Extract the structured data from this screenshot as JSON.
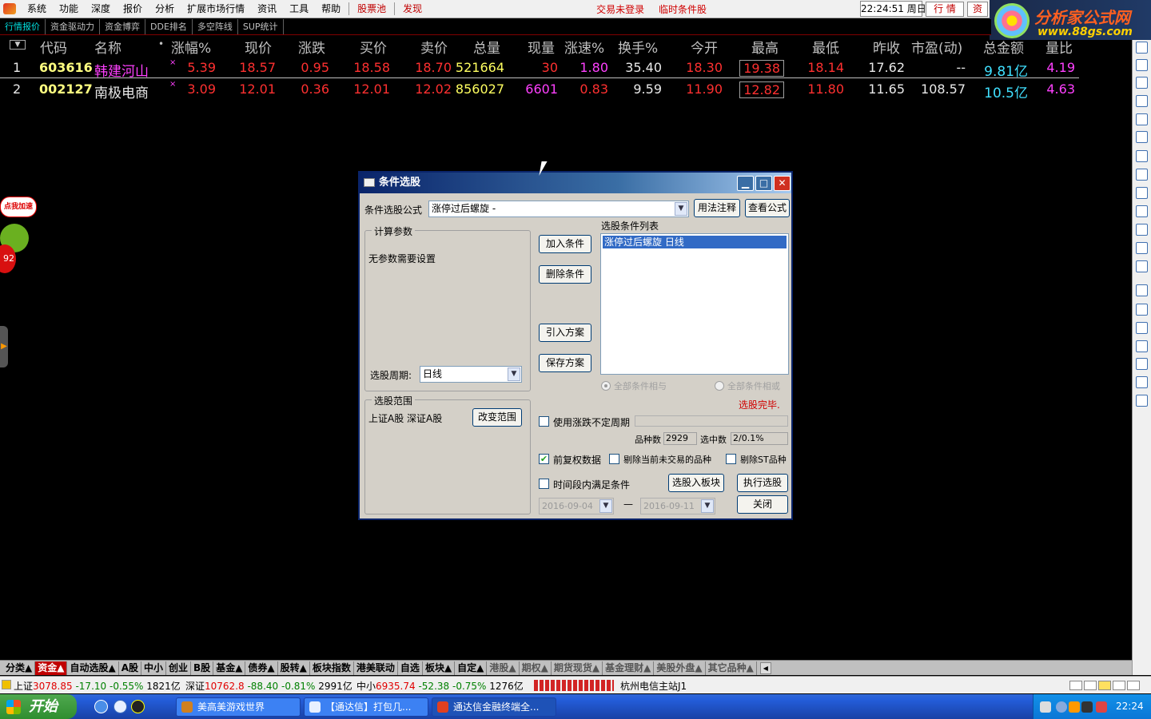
{
  "menu": {
    "items": [
      "系统",
      "功能",
      "深度",
      "报价",
      "分析",
      "扩展市场行情",
      "资讯",
      "工具",
      "帮助"
    ],
    "red_items": [
      "股票池",
      "发现"
    ],
    "trade_status": "交易未登录",
    "temp_condition": "临时条件股",
    "clock": "22:24:51 周日",
    "quote_btn": "行 情",
    "info_btn": "资"
  },
  "logo": {
    "title": "分析家公式网",
    "url": "www.88gs.com"
  },
  "tabs": [
    "行情报价",
    "资金驱动力",
    "资金博弈",
    "DDE排名",
    "多空阵线",
    "SUP统计"
  ],
  "table": {
    "headers": [
      "代码",
      "名称",
      "•",
      "涨幅%",
      "现价",
      "涨跌",
      "买价",
      "卖价",
      "总量",
      "现量",
      "涨速%",
      "换手%",
      "今开",
      "最高",
      "最低",
      "昨收",
      "市盈(动)",
      "总金额",
      "量比"
    ],
    "rows": [
      {
        "idx": "1",
        "code": "603616",
        "name": "韩建河山",
        "flag": "×",
        "pct": "5.39",
        "price": "18.57",
        "chg": "0.95",
        "bid": "18.58",
        "ask": "18.70",
        "vol": "521664",
        "curvol": "30",
        "speed": "1.80",
        "turnover": "35.40",
        "open": "18.30",
        "high": "19.38",
        "low": "18.14",
        "prev": "17.62",
        "pe": "--",
        "amount": "9.81亿",
        "ratio": "4.19"
      },
      {
        "idx": "2",
        "code": "002127",
        "name": "南极电商",
        "flag": "×",
        "pct": "3.09",
        "price": "12.01",
        "chg": "0.36",
        "bid": "12.01",
        "ask": "12.02",
        "vol": "856027",
        "curvol": "6601",
        "speed": "0.83",
        "turnover": "9.59",
        "open": "11.90",
        "high": "12.82",
        "low": "11.80",
        "prev": "11.65",
        "pe": "108.57",
        "amount": "10.5亿",
        "ratio": "4.63"
      }
    ]
  },
  "left_float": {
    "speed_badge": "点我加速",
    "score": "92"
  },
  "dialog": {
    "title": "条件选股",
    "formula_label": "条件选股公式",
    "formula_value": "涨停过后螺旋 -",
    "usage_btn": "用法注释",
    "view_btn": "查看公式",
    "params_group": "计算参数",
    "params_text": "无参数需要设置",
    "period_label": "选股周期:",
    "period_value": "日线",
    "add_btn": "加入条件",
    "delete_btn": "删除条件",
    "import_btn": "引入方案",
    "save_btn": "保存方案",
    "list_label": "选股条件列表",
    "list_item": "涨停过后螺旋   日线",
    "radio_and": "全部条件相与",
    "radio_or": "全部条件相或",
    "done_text": "选股完毕.",
    "range_group": "选股范围",
    "range_text": "上证A股 深证A股",
    "change_range_btn": "改变范围",
    "chk_uncertain": "使用涨跌不定周期",
    "count_label": "品种数",
    "count_value": "2929",
    "selected_label": "选中数",
    "selected_value": "2/0.1%",
    "chk_restore": "前复权数据",
    "chk_exclude_inactive": "剔除当前未交易的品种",
    "chk_exclude_st": "剔除ST品种",
    "chk_timerange": "时间段内满足条件",
    "to_block_btn": "选股入板块",
    "execute_btn": "执行选股",
    "date_from": "2016-09-04",
    "date_dash": "—",
    "date_to": "2016-09-11",
    "close_btn": "关闭"
  },
  "bottom_tabs": [
    "分类▲",
    "资金▲",
    "自动选股▲",
    "A股",
    "中小",
    "创业",
    "B股",
    "基金▲",
    "债券▲",
    "股转▲",
    "板块指数",
    "港美联动",
    "自选",
    "板块▲",
    "自定▲",
    "港股▲",
    "期权▲",
    "期货现货▲",
    "基金理财▲",
    "美股外盘▲",
    "其它品种▲"
  ],
  "status": {
    "sh_label": "上证",
    "sh_index": "3078.85",
    "sh_chg": "-17.10",
    "sh_pct": "-0.55%",
    "sh_amt": "1821亿",
    "sz_label": "深证",
    "sz_index": "10762.8",
    "sz_chg": "-88.40",
    "sz_pct": "-0.81%",
    "sz_amt": "2991亿",
    "zx_label": "中小",
    "zx_index": "6935.74",
    "zx_chg": "-52.38",
    "zx_pct": "-0.75%",
    "zx_amt": "1276亿",
    "server": "杭州电信主站J1"
  },
  "taskbar": {
    "start": "开始",
    "tasks": [
      "美高美游戏世界",
      "【通达信】打包几...",
      "通达信金融终端全..."
    ],
    "time": "22:24"
  },
  "colors": {
    "accent_red": "#ff3030",
    "dialog_title": "#0a246a",
    "done_red": "#d00000"
  }
}
